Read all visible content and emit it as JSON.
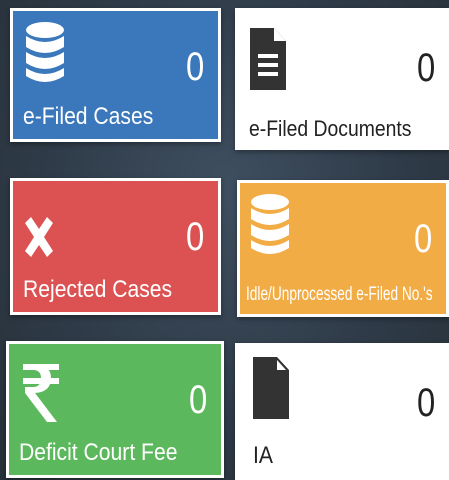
{
  "tiles": [
    {
      "id": "efiled_cases",
      "label": "e-Filed Cases",
      "count": "0",
      "icon": "database-icon",
      "color": "#3a77bb"
    },
    {
      "id": "efiled_documents",
      "label": "e-Filed Documents",
      "count": "0",
      "icon": "file-text-icon",
      "color": "#ffffff"
    },
    {
      "id": "rejected_cases",
      "label": "Rejected Cases",
      "count": "0",
      "icon": "close-icon",
      "color": "#dc5252"
    },
    {
      "id": "idle_unprocessed",
      "label": "Idle/Unprocessed e-Filed No.'s",
      "count": "0",
      "icon": "database-icon",
      "color": "#f2ac45"
    },
    {
      "id": "deficit_court_fee",
      "label": "Deficit Court Fee",
      "count": "0",
      "icon": "rupee-icon",
      "color": "#5cb85c"
    },
    {
      "id": "ia",
      "label": "IA",
      "count": "0",
      "icon": "file-icon",
      "color": "#ffffff"
    }
  ]
}
